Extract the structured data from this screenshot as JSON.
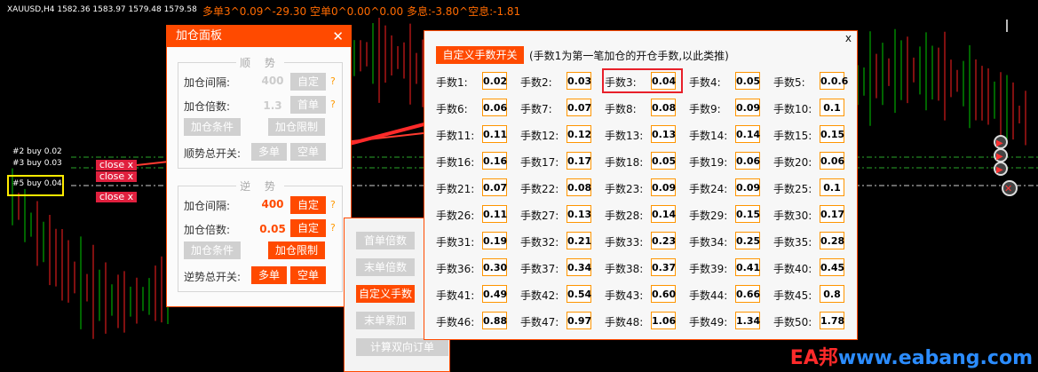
{
  "chart": {
    "symbol_text": "XAUUSD,H4  1582.36 1583.97 1579.48 1579.58",
    "stats_text": "多单3^0.09^-29.30  空单0^0.00^0.00  多息:-3.80^空息:-1.81",
    "trades": [
      {
        "label": "#2 buy 0.02"
      },
      {
        "label": "#3 buy 0.03"
      },
      {
        "label": "#5 buy 0.04"
      }
    ],
    "close_buttons": [
      "close x",
      "close x",
      "close x"
    ],
    "watermark": {
      "prefix": "EA邦",
      "url": "www.eabang.com"
    },
    "colors": {
      "bull": "#00c800",
      "bear": "#ff2020",
      "dash_green": "#2aa62a",
      "dash_white": "#cfcfcf"
    }
  },
  "add_panel": {
    "title": "加仓面板",
    "close": "✕",
    "trend": {
      "title": "顺 势",
      "interval_label": "加仓间隔:",
      "interval_value": "400",
      "interval_btn": "自定",
      "multiplier_label": "加仓倍数:",
      "multiplier_value": "1.3",
      "multiplier_btn": "首单",
      "condition_btn": "加仓条件",
      "limit_btn": "加仓限制",
      "switch_label": "顺势总开关:",
      "long_btn": "多单",
      "short_btn": "空单"
    },
    "counter": {
      "title": "逆 势",
      "interval_label": "加仓间隔:",
      "interval_value": "400",
      "interval_btn": "自定",
      "multiplier_label": "加仓倍数:",
      "multiplier_value": "0.05",
      "multiplier_btn": "自定",
      "condition_btn": "加仓条件",
      "limit_btn": "加仓限制",
      "switch_label": "逆势总开关:",
      "long_btn": "多单",
      "short_btn": "空单"
    },
    "help": "?"
  },
  "menu_panel": {
    "items": [
      {
        "label": "首单倍数",
        "active": false
      },
      {
        "label": "末单倍数",
        "active": false
      },
      {
        "label": "自定义手数",
        "active": true
      },
      {
        "label": "末单累加",
        "active": false
      },
      {
        "label": "计算双向订单",
        "active": false
      }
    ]
  },
  "lots_panel": {
    "close": "x",
    "toggle_btn": "自定义手数开关",
    "description": "(手数1为第一笔加仓的开仓手数,以此类推)",
    "lots": [
      {
        "label": "手数1:",
        "value": "0.02"
      },
      {
        "label": "手数2:",
        "value": "0.03"
      },
      {
        "label": "手数3:",
        "value": "0.04"
      },
      {
        "label": "手数4:",
        "value": "0.05"
      },
      {
        "label": "手数5:",
        "value": "0.0.6"
      },
      {
        "label": "手数6:",
        "value": "0.06"
      },
      {
        "label": "手数7:",
        "value": "0.07"
      },
      {
        "label": "手数8:",
        "value": "0.08"
      },
      {
        "label": "手数9:",
        "value": "0.09"
      },
      {
        "label": "手数10:",
        "value": "0.1"
      },
      {
        "label": "手数11:",
        "value": "0.11"
      },
      {
        "label": "手数12:",
        "value": "0.12"
      },
      {
        "label": "手数13:",
        "value": "0.13"
      },
      {
        "label": "手数14:",
        "value": "0.14"
      },
      {
        "label": "手数15:",
        "value": "0.15"
      },
      {
        "label": "手数16:",
        "value": "0.16"
      },
      {
        "label": "手数17:",
        "value": "0.17"
      },
      {
        "label": "手数18:",
        "value": "0.05"
      },
      {
        "label": "手数19:",
        "value": "0.06"
      },
      {
        "label": "手数20:",
        "value": "0.06"
      },
      {
        "label": "手数21:",
        "value": "0.07"
      },
      {
        "label": "手数22:",
        "value": "0.08"
      },
      {
        "label": "手数23:",
        "value": "0.09"
      },
      {
        "label": "手数24:",
        "value": "0.09"
      },
      {
        "label": "手数25:",
        "value": "0.1"
      },
      {
        "label": "手数26:",
        "value": "0.11"
      },
      {
        "label": "手数27:",
        "value": "0.13"
      },
      {
        "label": "手数28:",
        "value": "0.14"
      },
      {
        "label": "手数29:",
        "value": "0.15"
      },
      {
        "label": "手数30:",
        "value": "0.17"
      },
      {
        "label": "手数31:",
        "value": "0.19"
      },
      {
        "label": "手数32:",
        "value": "0.21"
      },
      {
        "label": "手数33:",
        "value": "0.23"
      },
      {
        "label": "手数34:",
        "value": "0.25"
      },
      {
        "label": "手数35:",
        "value": "0.28"
      },
      {
        "label": "手数36:",
        "value": "0.30"
      },
      {
        "label": "手数37:",
        "value": "0.34"
      },
      {
        "label": "手数38:",
        "value": "0.37"
      },
      {
        "label": "手数39:",
        "value": "0.41"
      },
      {
        "label": "手数40:",
        "value": "0.45"
      },
      {
        "label": "手数41:",
        "value": "0.49"
      },
      {
        "label": "手数42:",
        "value": "0.54"
      },
      {
        "label": "手数43:",
        "value": "0.60"
      },
      {
        "label": "手数44:",
        "value": "0.66"
      },
      {
        "label": "手数45:",
        "value": "0.8"
      },
      {
        "label": "手数46:",
        "value": "0.88"
      },
      {
        "label": "手数47:",
        "value": "0.97"
      },
      {
        "label": "手数48:",
        "value": "1.06"
      },
      {
        "label": "手数49:",
        "value": "1.34"
      },
      {
        "label": "手数50:",
        "value": "1.78"
      }
    ]
  }
}
